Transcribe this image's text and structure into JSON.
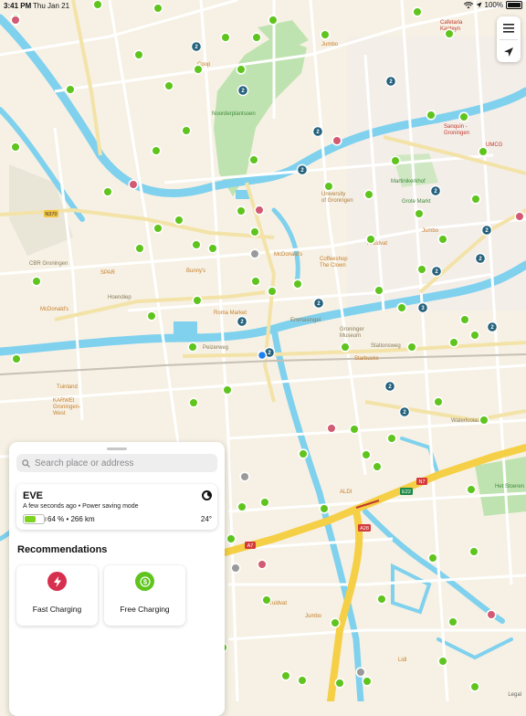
{
  "status_bar": {
    "time": "3:41 PM",
    "date": "Thu Jan 21",
    "battery": "100%"
  },
  "map": {
    "legal": "Legal",
    "labels": {
      "noorderplantsoen": "Noorderplantsoen",
      "university": "University\nof Groningen",
      "grote_markt": "Grote Markt",
      "martinikerkhof": "Martinikerkhof",
      "mcdonalds": "McDonald's",
      "coffeeshop": "Coffeeshop\nThe Clown",
      "kruidvat": "Kruidvat",
      "jumbo": "Jumbo",
      "sanquin": "Sanquin -\nGroningen",
      "umcg": "UMCG",
      "cbr": "CBR Groningen",
      "spar": "SPAR",
      "bunnys": "Bunny's",
      "mcdonalds2": "McDonald's",
      "roma": "Roma Market",
      "groninger_museum": "Groninger\nMuseum",
      "starbucks": "Starbucks",
      "stationsweg": "Stationsweg",
      "tuinland": "Tuinland",
      "karwei": "KARWEI\nGroningen-\nWest",
      "aldi": "ALDI",
      "lidl": "Lidl",
      "het_stoeren": "Het Stoeren",
      "cafetaria": "Cafetaria\nKapteyn",
      "coop": "Coop",
      "jumbo_north": "Jumbo",
      "jumbo_south": "Jumbo",
      "kruidvat_south": "Kruidvat",
      "hoendiep": "Hoendiep",
      "peizerweg": "Peizerweg",
      "emmasingel": "Emmasingel",
      "waterloolaan": "Waterloolaan",
      "h370": "N370",
      "a7": "A7",
      "n7": "N7",
      "e22": "E22",
      "a28": "A28"
    },
    "clusters": [
      "2",
      "2",
      "2",
      "2",
      "2",
      "2",
      "2",
      "2",
      "2",
      "2",
      "3",
      "2",
      "2",
      "2",
      "2",
      "2"
    ]
  },
  "map_buttons": {
    "menu_icon": "list-icon",
    "locate_icon": "location-arrow-icon"
  },
  "panel": {
    "search": {
      "placeholder": "Search place or address"
    },
    "vehicle": {
      "name": "EVE",
      "status": "A few seconds ago • Power saving mode",
      "battery_percent": 64,
      "charge_text": "64 % • 266 km",
      "temperature": "24°"
    },
    "recommendations_title": "Recommendations",
    "cards": [
      {
        "label": "Fast Charging",
        "icon": "lightning-icon",
        "color": "#d72f4e"
      },
      {
        "label": "Free Charging",
        "icon": "dollar-icon",
        "color": "#5fc41d"
      }
    ]
  },
  "colors": {
    "station_green": "#5fc41d",
    "station_red": "#d25a72",
    "station_grey": "#9a9a9a",
    "cluster": "#25617c",
    "water": "#7fd1ee",
    "park": "#bfe3b0",
    "highway": "#f5cf45"
  }
}
